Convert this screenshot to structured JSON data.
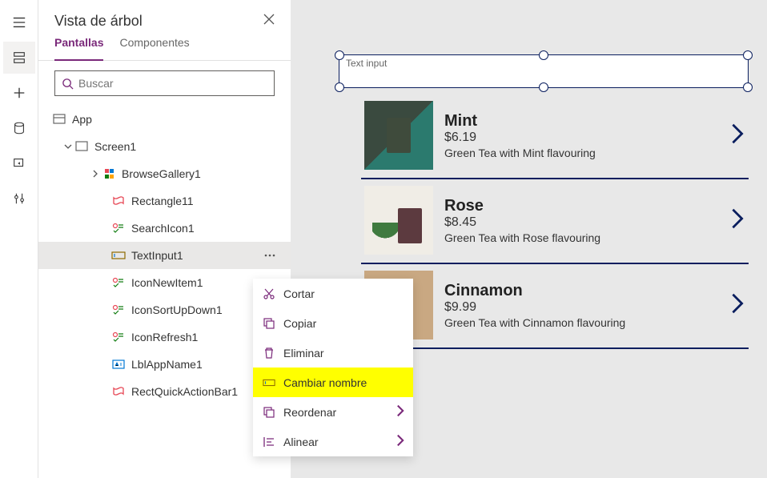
{
  "panel": {
    "title": "Vista de árbol",
    "tabs": {
      "screens": "Pantallas",
      "components": "Componentes"
    },
    "search_placeholder": "Buscar"
  },
  "tree": {
    "app": "App",
    "screen1": "Screen1",
    "browseGallery": "BrowseGallery1",
    "rectangle11": "Rectangle11",
    "searchIcon1": "SearchIcon1",
    "textInput1": "TextInput1",
    "iconNewItem1": "IconNewItem1",
    "iconSortUpDown1": "IconSortUpDown1",
    "iconRefresh1": "IconRefresh1",
    "lblAppName1": "LblAppName1",
    "rectQuickActionBar1": "RectQuickActionBar1"
  },
  "contextMenu": {
    "cut": "Cortar",
    "copy": "Copiar",
    "delete": "Eliminar",
    "rename": "Cambiar nombre",
    "reorder": "Reordenar",
    "align": "Alinear"
  },
  "canvas": {
    "textInputPlaceholder": "Text input"
  },
  "products": [
    {
      "name": "Mint",
      "price": "$6.19",
      "desc": "Green Tea with Mint flavouring"
    },
    {
      "name": "Rose",
      "price": "$8.45",
      "desc": "Green Tea with Rose flavouring"
    },
    {
      "name": "Cinnamon",
      "price": "$9.99",
      "desc": "Green Tea with Cinnamon flavouring"
    }
  ]
}
